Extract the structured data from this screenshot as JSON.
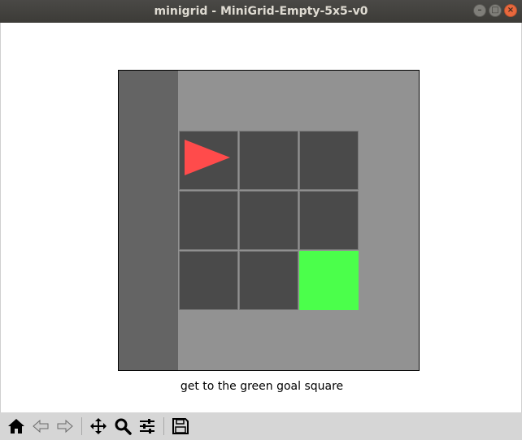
{
  "window": {
    "title": "minigrid - MiniGrid-Empty-5x5-v0"
  },
  "caption": "get to the green goal square",
  "grid": {
    "size": 5,
    "colors": {
      "wall": "#929292",
      "floor": "#4a4a4a",
      "grid_line": "#7a7a7a",
      "goal": "#4bff4b",
      "agent": "#ff4b4b",
      "shadow": "#646464"
    },
    "agent": {
      "col": 0,
      "row": 0,
      "direction": "right"
    },
    "goal": {
      "col": 2,
      "row": 2
    }
  },
  "toolbar": {
    "buttons": [
      {
        "name": "home-button",
        "icon": "home-icon"
      },
      {
        "name": "back-button",
        "icon": "arrow-left-icon"
      },
      {
        "name": "forward-button",
        "icon": "arrow-right-icon"
      },
      {
        "name": "pan-button",
        "icon": "move-icon"
      },
      {
        "name": "zoom-button",
        "icon": "magnifier-icon"
      },
      {
        "name": "configure-subplots-button",
        "icon": "sliders-icon"
      },
      {
        "name": "save-button",
        "icon": "floppy-disk-icon"
      }
    ]
  }
}
